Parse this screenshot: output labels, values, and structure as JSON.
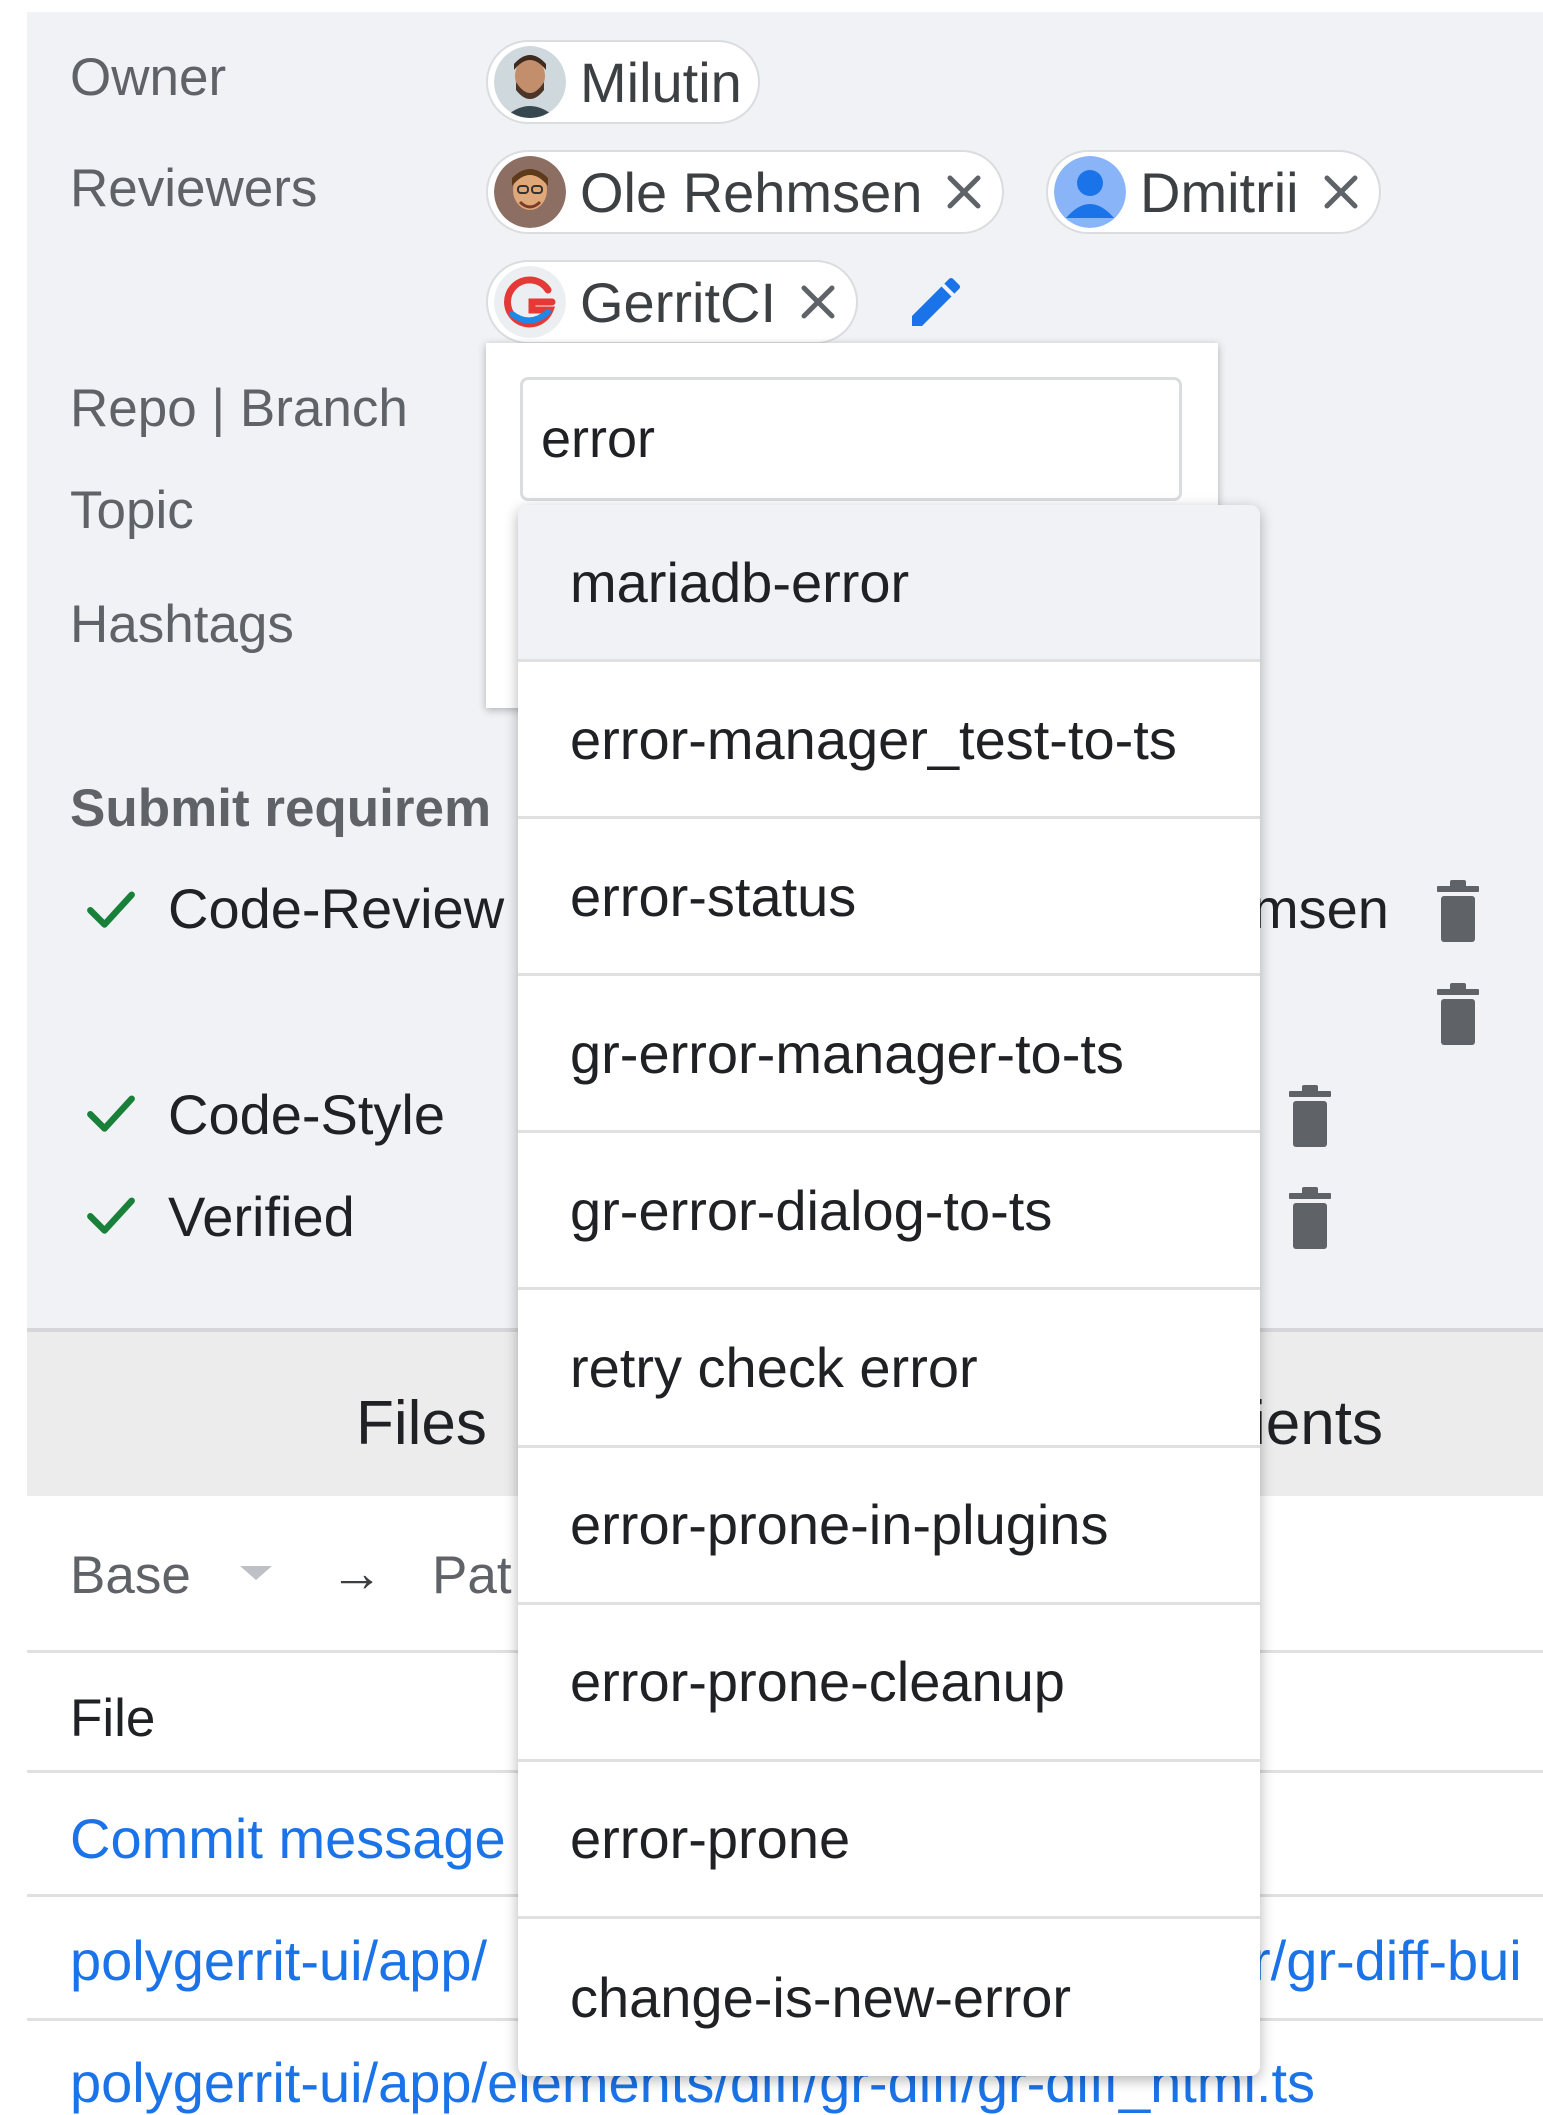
{
  "labels": {
    "owner": "Owner",
    "reviewers": "Reviewers",
    "repo_branch": "Repo | Branch",
    "topic": "Topic",
    "hashtags": "Hashtags",
    "submit_requirements": "Submit requirem"
  },
  "owner": {
    "name": "Milutin"
  },
  "reviewers": [
    {
      "name": "Ole Rehmsen"
    },
    {
      "name": "Dmitrii"
    },
    {
      "name": "GerritCI"
    }
  ],
  "topic_editor": {
    "value": "error",
    "suggestions": [
      "mariadb-error",
      "error-manager_test-to-ts",
      "error-status",
      "gr-error-manager-to-ts",
      "gr-error-dialog-to-ts",
      "retry check error",
      "error-prone-in-plugins",
      "error-prone-cleanup",
      "error-prone",
      "change-is-new-error"
    ]
  },
  "requirements": {
    "code_review": "Code-Review",
    "code_review_voter": "msen",
    "code_style": "Code-Style",
    "verified": "Verified"
  },
  "tabs": {
    "files": "Files",
    "comments": "ients"
  },
  "patchset": {
    "base": "Base",
    "arrow": "→",
    "patch": "Pat"
  },
  "file_table": {
    "header": "File",
    "rows": [
      {
        "left": "Commit message",
        "right": ""
      },
      {
        "left": "polygerrit-ui/app/",
        "right": "r/gr-diff-bui"
      },
      {
        "left": "polygerrit-ui/app/elements/diff/gr-diff/gr-diff_html.ts",
        "right": ""
      }
    ]
  },
  "colors": {
    "accent": "#1a73e8",
    "check_green": "#188038",
    "panel_bg": "#f1f2f5",
    "chip_border": "#dadce0"
  }
}
